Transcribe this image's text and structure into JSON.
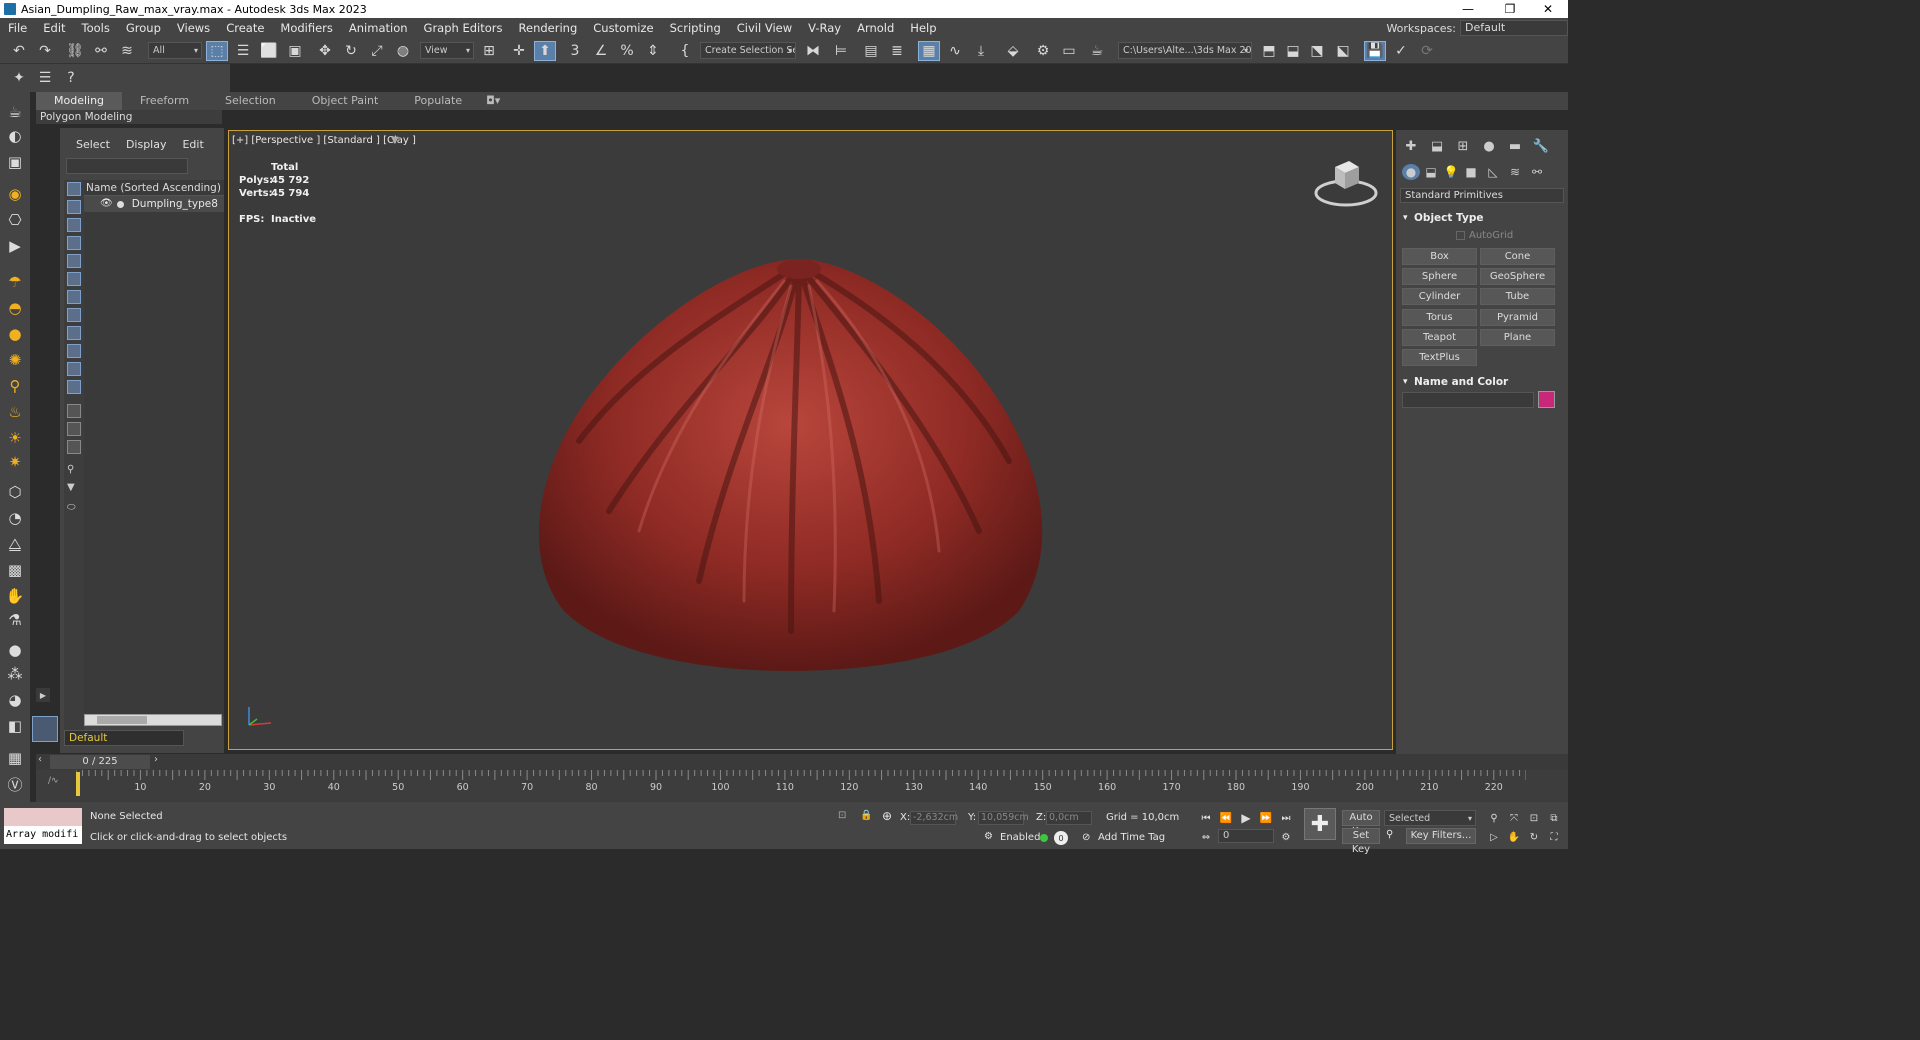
{
  "window": {
    "title": "Asian_Dumpling_Raw_max_vray.max - Autodesk 3ds Max 2023",
    "minimize": "—",
    "maximize": "❐",
    "close": "✕"
  },
  "menu": [
    "File",
    "Edit",
    "Tools",
    "Group",
    "Views",
    "Create",
    "Modifiers",
    "Animation",
    "Graph Editors",
    "Rendering",
    "Customize",
    "Scripting",
    "Civil View",
    "V-Ray",
    "Arnold",
    "Help"
  ],
  "workspace": {
    "label": "Workspaces:",
    "value": "Default"
  },
  "toolbar": {
    "selection_filter": "All",
    "ref_coord": "View",
    "named_selection": "Create Selection Se",
    "project_path": "C:\\Users\\Alte...\\3ds Max 202:"
  },
  "ribbon": {
    "tabs": [
      "Modeling",
      "Freeform",
      "Selection",
      "Object Paint",
      "Populate"
    ],
    "active": "Modeling",
    "subpanel": "Polygon Modeling"
  },
  "explorer": {
    "tabs": [
      "Select",
      "Display",
      "Edit"
    ],
    "header": "Name (Sorted Ascending)",
    "items": [
      {
        "name": "Dumpling_type8"
      }
    ],
    "layer": "Default"
  },
  "viewport": {
    "label": "[+] [Perspective ] [Standard ] [Clay ]",
    "stats": {
      "total_label": "Total",
      "polys_label": "Polys:",
      "polys": "45 792",
      "verts_label": "Verts:",
      "verts": "45 794",
      "fps_label": "FPS:",
      "fps": "Inactive"
    },
    "object_color": "#8e2a24"
  },
  "command_panel": {
    "category": "Standard Primitives",
    "object_type_title": "Object Type",
    "autogrid": "AutoGrid",
    "buttons": [
      "Box",
      "Cone",
      "Sphere",
      "GeoSphere",
      "Cylinder",
      "Tube",
      "Torus",
      "Pyramid",
      "Teapot",
      "Plane",
      "TextPlus"
    ],
    "name_color_title": "Name and Color",
    "swatch_color": "#c8287a"
  },
  "timeline": {
    "slider": "0 / 225",
    "ticks": [
      "10",
      "20",
      "30",
      "40",
      "50",
      "60",
      "70",
      "80",
      "90",
      "100",
      "110",
      "120",
      "130",
      "140",
      "150",
      "160",
      "170",
      "180",
      "190",
      "200",
      "210",
      "220"
    ]
  },
  "status": {
    "script_text": "Array modifi",
    "selection": "None Selected",
    "prompt": "Click or click-and-drag to select objects",
    "x_label": "X:",
    "x": "-2,632cm",
    "y_label": "Y:",
    "y": "10,059cm",
    "z_label": "Z:",
    "z": "0,0cm",
    "grid": "Grid = 10,0cm",
    "enabled_label": "Enabled:",
    "add_time_tag": "Add Time Tag",
    "auto_key": "Auto Key",
    "set_key": "Set Key",
    "key_mode": "Selected",
    "key_filters": "Key Filters...",
    "frame": "0"
  }
}
